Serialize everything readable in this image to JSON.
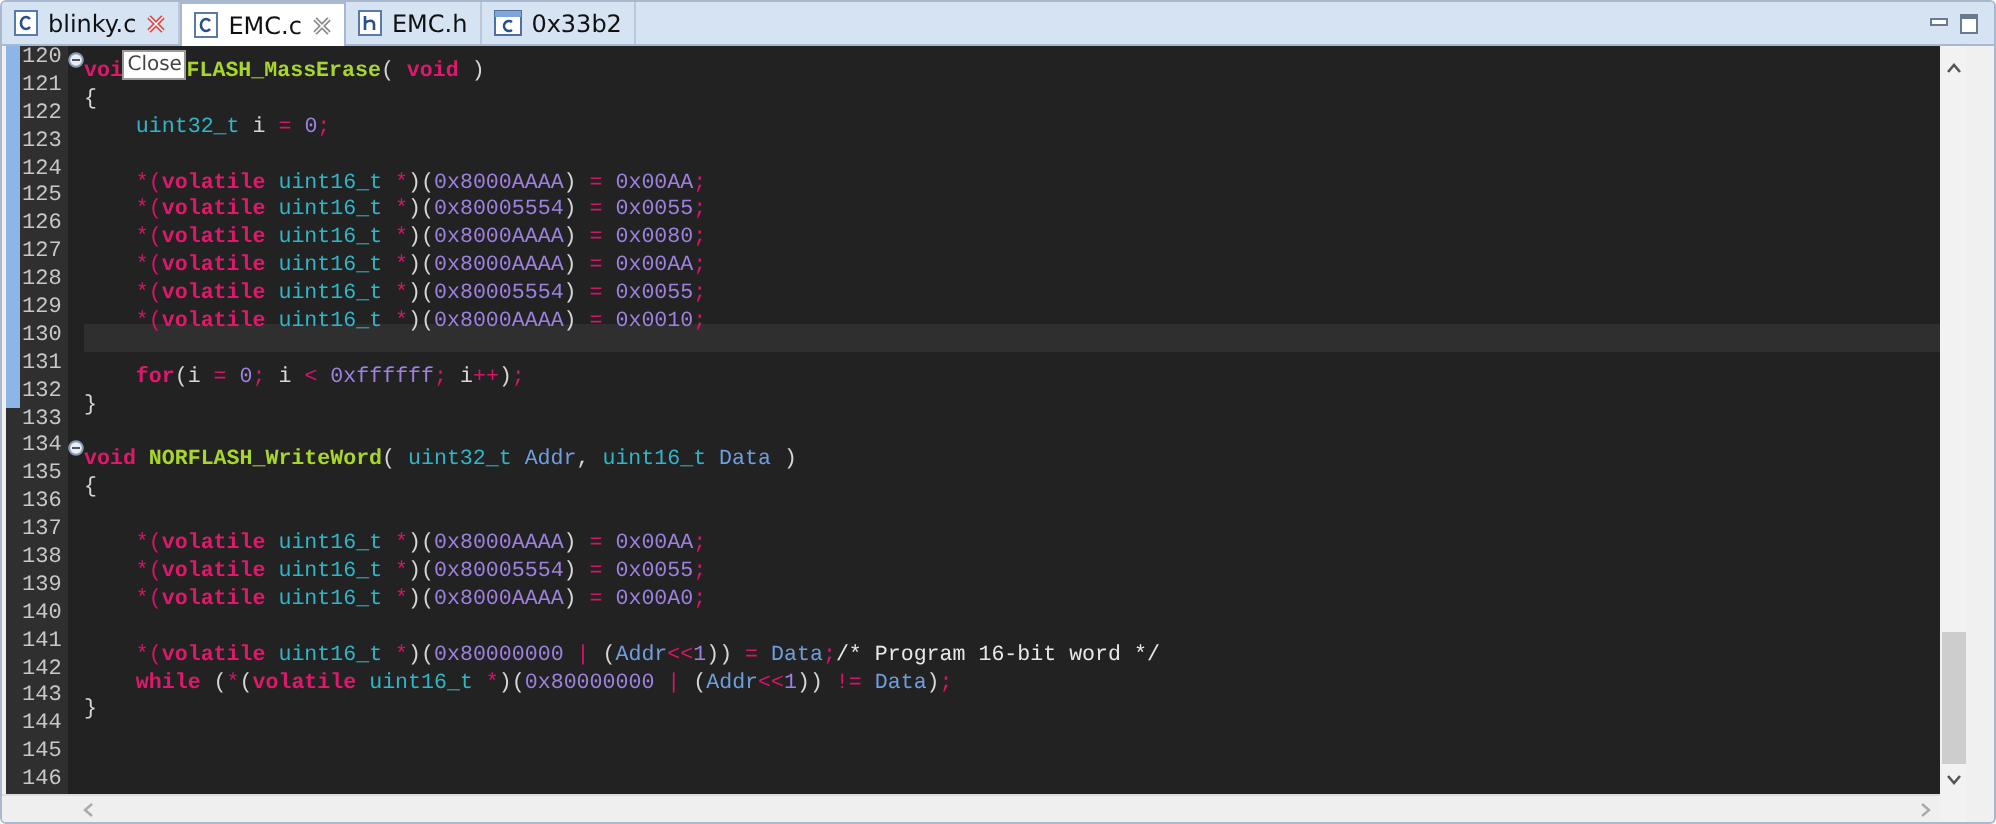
{
  "tabs": [
    {
      "label": "blinky.c",
      "kind": "c",
      "selected": false,
      "close_hovered": true
    },
    {
      "label": "EMC.c",
      "kind": "c",
      "selected": true,
      "close_hovered": false
    },
    {
      "label": "EMC.h",
      "kind": "h",
      "selected": false
    },
    {
      "label": "0x33b2",
      "kind": "c-window",
      "selected": false
    }
  ],
  "lines": [
    {
      "n": "120",
      "fold": true,
      "current": false,
      "changed": true,
      "tokens": [
        {
          "kind": "kw",
          "text": "voi"
        },
        {
          "kind": "tooltip",
          "text": "Close"
        },
        {
          "kind": "fn",
          "text": "FLASH_MassErase"
        },
        {
          "kind": "plain",
          "text": "( "
        },
        {
          "kind": "kw",
          "text": "void"
        },
        {
          "kind": "plain",
          "text": " )"
        }
      ]
    },
    {
      "n": "121",
      "fold": false,
      "current": false,
      "changed": true,
      "tokens": [
        {
          "kind": "plain",
          "text": "{"
        }
      ]
    },
    {
      "n": "122",
      "fold": false,
      "current": false,
      "changed": true,
      "tokens": [
        {
          "kind": "type",
          "text": "    uint32_t"
        },
        {
          "kind": "plain",
          "text": " i"
        },
        {
          "kind": "op",
          "text": " = "
        },
        {
          "kind": "num",
          "text": "0"
        },
        {
          "kind": "op",
          "text": ";"
        }
      ]
    },
    {
      "n": "123",
      "fold": false,
      "current": false,
      "changed": true
    },
    {
      "n": "124",
      "fold": false,
      "current": false,
      "changed": true,
      "tokens": [
        {
          "kind": "op",
          "text": "    *("
        },
        {
          "kind": "kw",
          "text": "volatile"
        },
        {
          "kind": "type",
          "text": " uint16_t"
        },
        {
          "kind": "op",
          "text": " *"
        },
        {
          "kind": "plain",
          "text": ")("
        },
        {
          "kind": "num",
          "text": "0x8000AAAA"
        },
        {
          "kind": "plain",
          "text": ")"
        },
        {
          "kind": "op",
          "text": " = "
        },
        {
          "kind": "num",
          "text": "0x00AA"
        },
        {
          "kind": "op",
          "text": ";"
        }
      ]
    },
    {
      "n": "125",
      "fold": false,
      "current": false,
      "changed": true,
      "tokens": [
        {
          "kind": "op",
          "text": "    *("
        },
        {
          "kind": "kw",
          "text": "volatile"
        },
        {
          "kind": "type",
          "text": " uint16_t"
        },
        {
          "kind": "op",
          "text": " *"
        },
        {
          "kind": "plain",
          "text": ")("
        },
        {
          "kind": "num",
          "text": "0x80005554"
        },
        {
          "kind": "plain",
          "text": ")"
        },
        {
          "kind": "op",
          "text": " = "
        },
        {
          "kind": "num",
          "text": "0x0055"
        },
        {
          "kind": "op",
          "text": ";"
        }
      ]
    },
    {
      "n": "126",
      "fold": false,
      "current": false,
      "changed": true,
      "tokens": [
        {
          "kind": "op",
          "text": "    *("
        },
        {
          "kind": "kw",
          "text": "volatile"
        },
        {
          "kind": "type",
          "text": " uint16_t"
        },
        {
          "kind": "op",
          "text": " *"
        },
        {
          "kind": "plain",
          "text": ")("
        },
        {
          "kind": "num",
          "text": "0x8000AAAA"
        },
        {
          "kind": "plain",
          "text": ")"
        },
        {
          "kind": "op",
          "text": " = "
        },
        {
          "kind": "num",
          "text": "0x0080"
        },
        {
          "kind": "op",
          "text": ";"
        }
      ]
    },
    {
      "n": "127",
      "fold": false,
      "current": false,
      "changed": true,
      "tokens": [
        {
          "kind": "op",
          "text": "    *("
        },
        {
          "kind": "kw",
          "text": "volatile"
        },
        {
          "kind": "type",
          "text": " uint16_t"
        },
        {
          "kind": "op",
          "text": " *"
        },
        {
          "kind": "plain",
          "text": ")("
        },
        {
          "kind": "num",
          "text": "0x8000AAAA"
        },
        {
          "kind": "plain",
          "text": ")"
        },
        {
          "kind": "op",
          "text": " = "
        },
        {
          "kind": "num",
          "text": "0x00AA"
        },
        {
          "kind": "op",
          "text": ";"
        }
      ]
    },
    {
      "n": "128",
      "fold": false,
      "current": false,
      "changed": true,
      "tokens": [
        {
          "kind": "op",
          "text": "    *("
        },
        {
          "kind": "kw",
          "text": "volatile"
        },
        {
          "kind": "type",
          "text": " uint16_t"
        },
        {
          "kind": "op",
          "text": " *"
        },
        {
          "kind": "plain",
          "text": ")("
        },
        {
          "kind": "num",
          "text": "0x80005554"
        },
        {
          "kind": "plain",
          "text": ")"
        },
        {
          "kind": "op",
          "text": " = "
        },
        {
          "kind": "num",
          "text": "0x0055"
        },
        {
          "kind": "op",
          "text": ";"
        }
      ]
    },
    {
      "n": "129",
      "fold": false,
      "current": false,
      "changed": true,
      "tokens": [
        {
          "kind": "op",
          "text": "    *("
        },
        {
          "kind": "kw",
          "text": "volatile"
        },
        {
          "kind": "type",
          "text": " uint16_t"
        },
        {
          "kind": "op",
          "text": " *"
        },
        {
          "kind": "plain",
          "text": ")("
        },
        {
          "kind": "num",
          "text": "0x8000AAAA"
        },
        {
          "kind": "plain",
          "text": ")"
        },
        {
          "kind": "op",
          "text": " = "
        },
        {
          "kind": "num",
          "text": "0x0010"
        },
        {
          "kind": "op",
          "text": ";"
        }
      ]
    },
    {
      "n": "130",
      "fold": false,
      "current": true,
      "changed": true
    },
    {
      "n": "131",
      "fold": false,
      "current": false,
      "changed": true,
      "tokens": [
        {
          "kind": "kw",
          "text": "    for"
        },
        {
          "kind": "plain",
          "text": "(i"
        },
        {
          "kind": "op",
          "text": " = "
        },
        {
          "kind": "num",
          "text": "0"
        },
        {
          "kind": "op",
          "text": ";"
        },
        {
          "kind": "plain",
          "text": " i"
        },
        {
          "kind": "op",
          "text": " < "
        },
        {
          "kind": "num",
          "text": "0xffffff"
        },
        {
          "kind": "op",
          "text": ";"
        },
        {
          "kind": "plain",
          "text": " i"
        },
        {
          "kind": "op",
          "text": "++"
        },
        {
          "kind": "plain",
          "text": ")"
        },
        {
          "kind": "op",
          "text": ";"
        }
      ]
    },
    {
      "n": "132",
      "fold": false,
      "current": false,
      "changed": true,
      "tokens": [
        {
          "kind": "plain",
          "text": "}"
        }
      ]
    },
    {
      "n": "133",
      "fold": false,
      "current": false,
      "changed": false
    },
    {
      "n": "134",
      "fold": true,
      "current": false,
      "changed": false,
      "tokens": [
        {
          "kind": "kw",
          "text": "void"
        },
        {
          "kind": "fn",
          "text": " NORFLASH_WriteWord"
        },
        {
          "kind": "plain",
          "text": "( "
        },
        {
          "kind": "type",
          "text": "uint32_t"
        },
        {
          "kind": "var",
          "text": " Addr"
        },
        {
          "kind": "plain",
          "text": ", "
        },
        {
          "kind": "type",
          "text": "uint16_t"
        },
        {
          "kind": "var",
          "text": " Data"
        },
        {
          "kind": "plain",
          "text": " )"
        }
      ]
    },
    {
      "n": "135",
      "fold": false,
      "current": false,
      "changed": false,
      "tokens": [
        {
          "kind": "plain",
          "text": "{"
        }
      ]
    },
    {
      "n": "136",
      "fold": false,
      "current": false,
      "changed": false
    },
    {
      "n": "137",
      "fold": false,
      "current": false,
      "changed": false,
      "tokens": [
        {
          "kind": "op",
          "text": "    *("
        },
        {
          "kind": "kw",
          "text": "volatile"
        },
        {
          "kind": "type",
          "text": " uint16_t"
        },
        {
          "kind": "op",
          "text": " *"
        },
        {
          "kind": "plain",
          "text": ")("
        },
        {
          "kind": "num",
          "text": "0x8000AAAA"
        },
        {
          "kind": "plain",
          "text": ")"
        },
        {
          "kind": "op",
          "text": " = "
        },
        {
          "kind": "num",
          "text": "0x00AA"
        },
        {
          "kind": "op",
          "text": ";"
        }
      ]
    },
    {
      "n": "138",
      "fold": false,
      "current": false,
      "changed": false,
      "tokens": [
        {
          "kind": "op",
          "text": "    *("
        },
        {
          "kind": "kw",
          "text": "volatile"
        },
        {
          "kind": "type",
          "text": " uint16_t"
        },
        {
          "kind": "op",
          "text": " *"
        },
        {
          "kind": "plain",
          "text": ")("
        },
        {
          "kind": "num",
          "text": "0x80005554"
        },
        {
          "kind": "plain",
          "text": ")"
        },
        {
          "kind": "op",
          "text": " = "
        },
        {
          "kind": "num",
          "text": "0x0055"
        },
        {
          "kind": "op",
          "text": ";"
        }
      ]
    },
    {
      "n": "139",
      "fold": false,
      "current": false,
      "changed": false,
      "tokens": [
        {
          "kind": "op",
          "text": "    *("
        },
        {
          "kind": "kw",
          "text": "volatile"
        },
        {
          "kind": "type",
          "text": " uint16_t"
        },
        {
          "kind": "op",
          "text": " *"
        },
        {
          "kind": "plain",
          "text": ")("
        },
        {
          "kind": "num",
          "text": "0x8000AAAA"
        },
        {
          "kind": "plain",
          "text": ")"
        },
        {
          "kind": "op",
          "text": " = "
        },
        {
          "kind": "num",
          "text": "0x00A0"
        },
        {
          "kind": "op",
          "text": ";"
        }
      ]
    },
    {
      "n": "140",
      "fold": false,
      "current": false,
      "changed": false
    },
    {
      "n": "141",
      "fold": false,
      "current": false,
      "changed": false,
      "tokens": [
        {
          "kind": "op",
          "text": "    *("
        },
        {
          "kind": "kw",
          "text": "volatile"
        },
        {
          "kind": "type",
          "text": " uint16_t"
        },
        {
          "kind": "op",
          "text": " *"
        },
        {
          "kind": "plain",
          "text": ")("
        },
        {
          "kind": "num",
          "text": "0x80000000"
        },
        {
          "kind": "op",
          "text": " | "
        },
        {
          "kind": "plain",
          "text": "("
        },
        {
          "kind": "var",
          "text": "Addr"
        },
        {
          "kind": "op",
          "text": "<<"
        },
        {
          "kind": "num",
          "text": "1"
        },
        {
          "kind": "plain",
          "text": "))"
        },
        {
          "kind": "op",
          "text": " = "
        },
        {
          "kind": "var",
          "text": "Data"
        },
        {
          "kind": "op",
          "text": ";"
        },
        {
          "kind": "comment",
          "text": "/* Program 16-bit word */"
        }
      ]
    },
    {
      "n": "142",
      "fold": false,
      "current": false,
      "changed": false,
      "tokens": [
        {
          "kind": "kw",
          "text": "    while"
        },
        {
          "kind": "plain",
          "text": " ("
        },
        {
          "kind": "op",
          "text": "*"
        },
        {
          "kind": "plain",
          "text": "("
        },
        {
          "kind": "kw",
          "text": "volatile"
        },
        {
          "kind": "type",
          "text": " uint16_t"
        },
        {
          "kind": "op",
          "text": " *"
        },
        {
          "kind": "plain",
          "text": ")("
        },
        {
          "kind": "num",
          "text": "0x80000000"
        },
        {
          "kind": "op",
          "text": " | "
        },
        {
          "kind": "plain",
          "text": "("
        },
        {
          "kind": "var",
          "text": "Addr"
        },
        {
          "kind": "op",
          "text": "<<"
        },
        {
          "kind": "num",
          "text": "1"
        },
        {
          "kind": "plain",
          "text": "))"
        },
        {
          "kind": "op",
          "text": " != "
        },
        {
          "kind": "var",
          "text": "Data"
        },
        {
          "kind": "plain",
          "text": ")"
        },
        {
          "kind": "op",
          "text": ";"
        }
      ]
    },
    {
      "n": "143",
      "fold": false,
      "current": false,
      "changed": false,
      "tokens": [
        {
          "kind": "plain",
          "text": "}"
        }
      ]
    },
    {
      "n": "144",
      "fold": false,
      "current": false,
      "changed": false
    },
    {
      "n": "145",
      "fold": false,
      "current": false,
      "changed": false
    },
    {
      "n": "146",
      "fold": false,
      "current": false,
      "changed": false
    }
  ]
}
